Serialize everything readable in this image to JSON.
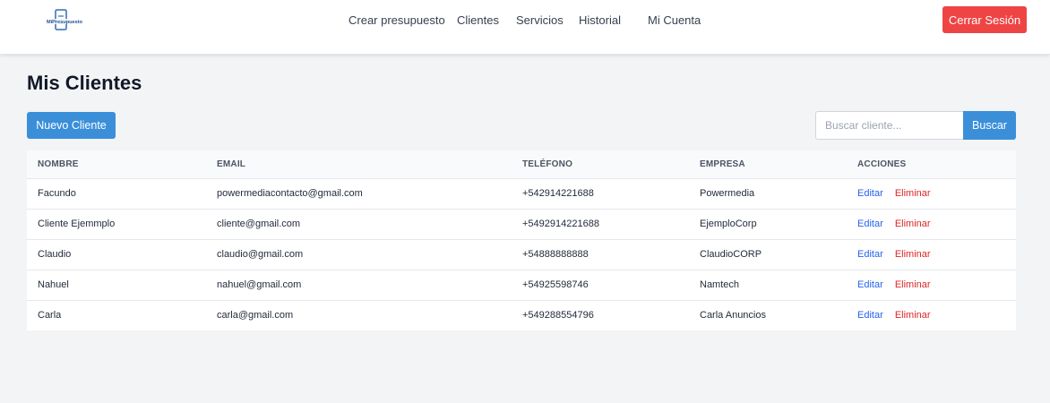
{
  "nav": {
    "links": [
      "Crear presupuesto",
      "Clientes",
      "Servicios",
      "Historial",
      "Mi Cuenta"
    ],
    "logout_label": "Cerrar Sesión",
    "logo_text": "MiPresupuesto"
  },
  "page": {
    "title": "Mis Clientes",
    "new_client_label": "Nuevo Cliente",
    "search_placeholder": "Buscar cliente...",
    "search_button_label": "Buscar"
  },
  "table": {
    "headers": [
      "NOMBRE",
      "EMAIL",
      "TELÉFONO",
      "EMPRESA",
      "ACCIONES"
    ],
    "rows": [
      {
        "nombre": "Facundo",
        "email": "powermediacontacto@gmail.com",
        "telefono": "+542914221688",
        "empresa": "Powermedia"
      },
      {
        "nombre": "Cliente Ejemmplo",
        "email": "cliente@gmail.com",
        "telefono": "+5492914221688",
        "empresa": "EjemploCorp"
      },
      {
        "nombre": "Claudio",
        "email": "claudio@gmail.com",
        "telefono": "+54888888888",
        "empresa": "ClaudioCORP"
      },
      {
        "nombre": "Nahuel",
        "email": "nahuel@gmail.com",
        "telefono": "+54925598746",
        "empresa": "Namtech"
      },
      {
        "nombre": "Carla",
        "email": "carla@gmail.com",
        "telefono": "+549288554796",
        "empresa": "Carla Anuncios"
      }
    ],
    "edit_label": "Editar",
    "delete_label": "Eliminar"
  },
  "colors": {
    "primary": "#3b8fd9",
    "danger": "#ef4444",
    "edit_link": "#2563eb",
    "delete_link": "#dc2626",
    "background": "#f3f4f6"
  }
}
